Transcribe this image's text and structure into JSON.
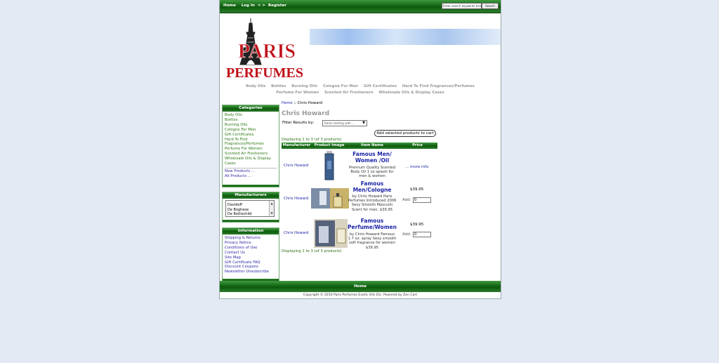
{
  "topnav": {
    "home": "Home",
    "login": "Log In",
    "sep": "< >",
    "register": "Register"
  },
  "search": {
    "placeholder": "Enter search keywords here",
    "button": "Search"
  },
  "logo": {
    "line1": "PARIS",
    "line2": "PERFUMES"
  },
  "categories_nav": {
    "line1": [
      "Body Oils",
      "Bottles",
      "Burning Oils",
      "Cologne For Men",
      "Gift Certificates",
      "Hard To Find Fragrances/Perfumes"
    ],
    "line2": [
      "Perfume For Women",
      "Scented Air Fresheners",
      "Wholesale Oils & Display Cases"
    ]
  },
  "sidebar": {
    "categories": {
      "title": "Categories",
      "items": [
        "Body Oils",
        "Bottles",
        "Burning Oils",
        "Cologne For Men",
        "Gift Certificates",
        "Hard To Find",
        "Fragrances/Perfumes",
        "Perfume For Women",
        "Scented Air Fresheners",
        "Wholesale Oils & Display",
        "Cases"
      ],
      "new_products": "New Products ...",
      "all_products": "All Products ..."
    },
    "manufacturers": {
      "title": "Manufacturers",
      "options": [
        "Davidoff",
        "De Boghese",
        "De Rothschild"
      ]
    },
    "information": {
      "title": "Information",
      "items": [
        "Shipping & Returns",
        "Privacy Notice",
        "Conditions of Use",
        "Contact Us",
        "Site Map",
        "Gift Certificate FAQ",
        "Discount Coupons",
        "Newsletter Unsubscribe"
      ]
    }
  },
  "main": {
    "breadcrumb_home": "Home",
    "breadcrumb_sep": "::",
    "breadcrumb_current": "Chris Howard",
    "heading": "Chris Howard",
    "filter_label": "Filter Results by:",
    "filter_value": "Items starting with ...",
    "add_selected_button": "Add selected products to cart",
    "displaying": "Displaying 1 to 3 (of 3 products)",
    "columns": [
      "Manufacturer",
      "Product Image",
      "Item Name",
      "Price"
    ],
    "products": [
      {
        "manufacturer": "Chris Howard",
        "name": "Famous Men/ Women /Oil",
        "desc": "Premium Quality Scented Body Oil 1 oz splash for men & women",
        "price": "",
        "action": "... more info"
      },
      {
        "manufacturer": "Chris Howard",
        "name": "Famous Men/Cologne",
        "desc": "by Chris Howard Paris Perfumes Introduced 2006 Sexy Smooth Masculin Scent for men. $39.95",
        "price": "$39.95",
        "add_label": "Add:",
        "qty": "0"
      },
      {
        "manufacturer": "Chris Howard",
        "name": "Famous Perfume/Women",
        "desc": "by Chris Howard Famous 1.7 oz. spray Sexy smooth soft fragrance for women $39.95",
        "price": "$39.95",
        "add_label": "Add:",
        "qty": "0"
      }
    ]
  },
  "footer": {
    "home": "Home",
    "copyright": "Copyright © 2010 Paris Perfumes Exotic Oils Etc. Powered by Zen Cart"
  },
  "colors": {
    "green_dark": "#0b5a0b",
    "green_light": "#3f9a3f",
    "link": "#1c24a6",
    "banner": "#9ec0ee",
    "logo_red": "#c0101a"
  }
}
